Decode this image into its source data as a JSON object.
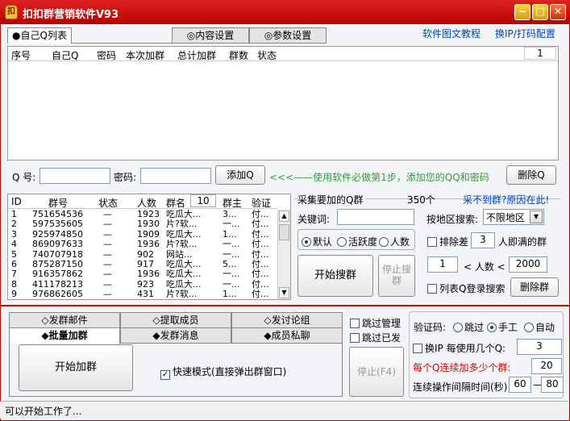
{
  "window": {
    "title": "扣扣群营销软件V93",
    "app_icon_glyph": "扣"
  },
  "top_tabs": [
    {
      "label": "●自己Q列表"
    },
    {
      "label": "◎内容设置"
    },
    {
      "label": "◎参数设置"
    }
  ],
  "links": {
    "tutorial": "软件图文教程",
    "change_ip": "换IP/打码配置",
    "cant_find": "采不到群?原因在此!"
  },
  "qq_table": {
    "headers": [
      "序号",
      "自己Q",
      "密码",
      "本次加群",
      "总计加群",
      "群数",
      "状态"
    ],
    "page_num": "1"
  },
  "qq_form": {
    "qq_label": "Q 号:",
    "qq_value": "",
    "pwd_label": "密码:",
    "pwd_value": "",
    "add_button": "添加Q",
    "hint": "<<<——使用软件必做第1步，添加您的QQ和密码",
    "delete_button": "删除Q"
  },
  "group_table": {
    "headers": [
      "ID",
      "群号",
      "状态",
      "人数",
      "群名",
      "10",
      "群主",
      "验证"
    ],
    "rows": [
      [
        "1",
        "751654536",
        "—",
        "1923",
        "吃瓜大...",
        "3...",
        "付..."
      ],
      [
        "2",
        "597535605",
        "—",
        "1930",
        "片?软...",
        "一...",
        "付..."
      ],
      [
        "3",
        "925974850",
        "—",
        "1909",
        "吃瓜大...",
        "1...",
        "付..."
      ],
      [
        "4",
        "869097633",
        "—",
        "1936",
        "片?软...",
        "一...",
        "付..."
      ],
      [
        "5",
        "740707918",
        "—",
        "902",
        "网站...",
        "一...",
        "付..."
      ],
      [
        "6",
        "875287150",
        "—",
        "917",
        "吃瓜大...",
        "5...",
        "付..."
      ],
      [
        "7",
        "916357862",
        "—",
        "1936",
        "吃瓜大...",
        "一...",
        "付..."
      ],
      [
        "8",
        "411178213",
        "—",
        "923",
        "吃瓜大...",
        "一...",
        "付..."
      ],
      [
        "9",
        "976862605",
        "—",
        "431",
        "片?软...",
        "1...",
        "付..."
      ]
    ]
  },
  "collect": {
    "section_title": "采集要加的Q群",
    "count": "350个",
    "keyword_label": "关键词:",
    "keyword_value": "",
    "region_label": "按地区搜索:",
    "region_value": "不限地区",
    "radios": [
      "默认",
      "活跃度",
      "人数"
    ],
    "exclude_label": "排除差",
    "exclude_value": "3",
    "exclude_suffix": "人即满的群",
    "start_search": "开始搜群",
    "stop_search": "停止搜群",
    "min_people": "1",
    "people_label": "< 人数 <",
    "max_people": "2000",
    "list_login_label": "列表Q登录搜索",
    "delete_group_button": "删除群"
  },
  "bottom_tabs": {
    "row1": [
      "◇发群邮件",
      "◇提取成员",
      "◇发讨论组"
    ],
    "row2": [
      "◆批量加群",
      "◆发群消息",
      "◆成员私聊"
    ]
  },
  "checks": {
    "skip_manage": "跳过管理",
    "skip_sent": "跳过已发"
  },
  "batch": {
    "start_button": "开始加群",
    "fast_mode": "快速模式(直接弹出群窗口)",
    "stop_button": "停止(F4)"
  },
  "captcha": {
    "label": "验证码:",
    "options": [
      "跳过",
      "手工",
      "自动"
    ],
    "change_ip_label": "换IP 每使用几个Q:",
    "change_ip_value": "3",
    "max_groups_label": "每个Q连续加多少个群:",
    "max_groups_value": "20",
    "interval_label": "连续操作间隔时间(秒)",
    "interval_min": "60",
    "interval_max": "80"
  },
  "status_text": "可以开始工作了..."
}
